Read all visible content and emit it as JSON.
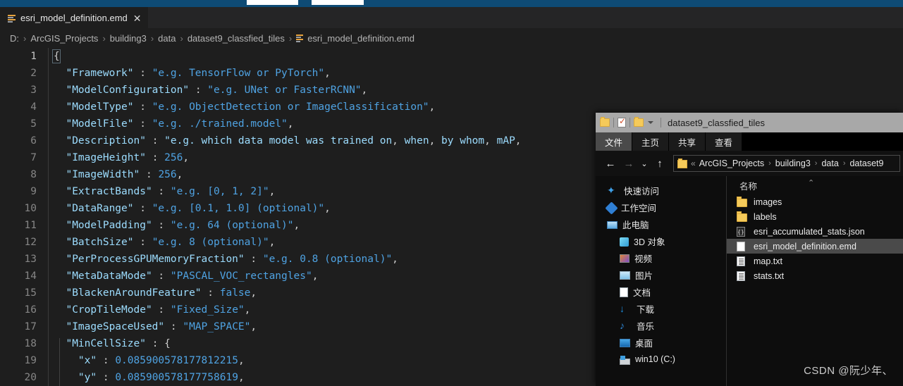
{
  "top_strip": {
    "color": "#0e4b75"
  },
  "editor": {
    "tab": {
      "label": "esri_model_definition.emd",
      "close_glyph": "✕",
      "icon": "json-lines-icon"
    },
    "breadcrumb": {
      "separator": "›",
      "parts": [
        "D:",
        "ArcGIS_Projects",
        "building3",
        "data",
        "dataset9_classfied_tiles"
      ],
      "file": "esri_model_definition.emd"
    },
    "lines": [
      {
        "n": "1",
        "text": "{"
      },
      {
        "n": "2",
        "text": "  \"Framework\" : \"e.g. TensorFlow or PyTorch\","
      },
      {
        "n": "3",
        "text": "  \"ModelConfiguration\" : \"e.g. UNet or FasterRCNN\","
      },
      {
        "n": "4",
        "text": "  \"ModelType\" : \"e.g. ObjectDetection or ImageClassification\","
      },
      {
        "n": "5",
        "text": "  \"ModelFile\" : \"e.g. ./trained.model\","
      },
      {
        "n": "6",
        "text": "  \"Description\" : \"e.g. which data model was trained on, when, by whom, mAP,"
      },
      {
        "n": "7",
        "text": "  \"ImageHeight\" : 256,"
      },
      {
        "n": "8",
        "text": "  \"ImageWidth\" : 256,"
      },
      {
        "n": "9",
        "text": "  \"ExtractBands\" : \"e.g. [0, 1, 2]\","
      },
      {
        "n": "10",
        "text": "  \"DataRange\" : \"e.g. [0.1, 1.0] (optional)\","
      },
      {
        "n": "11",
        "text": "  \"ModelPadding\" : \"e.g. 64 (optional)\","
      },
      {
        "n": "12",
        "text": "  \"BatchSize\" : \"e.g. 8 (optional)\","
      },
      {
        "n": "13",
        "text": "  \"PerProcessGPUMemoryFraction\" : \"e.g. 0.8 (optional)\","
      },
      {
        "n": "14",
        "text": "  \"MetaDataMode\" : \"PASCAL_VOC_rectangles\","
      },
      {
        "n": "15",
        "text": "  \"BlackenAroundFeature\" : false,"
      },
      {
        "n": "16",
        "text": "  \"CropTileMode\" : \"Fixed_Size\","
      },
      {
        "n": "17",
        "text": "  \"ImageSpaceUsed\" : \"MAP_SPACE\","
      },
      {
        "n": "18",
        "text": "  \"MinCellSize\" : {"
      },
      {
        "n": "19",
        "text": "    \"x\" : 0.085900578177812215,"
      },
      {
        "n": "20",
        "text": "    \"y\" : 0.085900578177758619,"
      }
    ]
  },
  "explorer": {
    "title": "dataset9_classfied_tiles",
    "quick_access": [
      "folder-icon",
      "properties-icon",
      "new-folder-icon",
      "customize-caret-icon"
    ],
    "ribbon_tabs": [
      {
        "label": "文件",
        "active": true
      },
      {
        "label": "主页",
        "active": false
      },
      {
        "label": "共享",
        "active": false
      },
      {
        "label": "查看",
        "active": false
      }
    ],
    "nav": {
      "back_glyph": "←",
      "forward_glyph": "→",
      "recent_glyph": "⌄",
      "up_glyph": "↑",
      "address_chevrons": "«",
      "address_parts": [
        "ArcGIS_Projects",
        "building3",
        "data",
        "dataset9"
      ],
      "address_separator": "›"
    },
    "sidebar": [
      {
        "label": "快速访问",
        "icon": "star-icon",
        "indent": false
      },
      {
        "label": "工作空间",
        "icon": "diamond-icon",
        "indent": false
      },
      {
        "label": "此电脑",
        "icon": "this-pc-icon",
        "indent": false
      },
      {
        "label": "3D 对象",
        "icon": "cube-icon",
        "indent": true
      },
      {
        "label": "视频",
        "icon": "video-icon",
        "indent": true
      },
      {
        "label": "图片",
        "icon": "pictures-icon",
        "indent": true
      },
      {
        "label": "文档",
        "icon": "documents-icon",
        "indent": true
      },
      {
        "label": "下载",
        "icon": "downloads-icon",
        "indent": true
      },
      {
        "label": "音乐",
        "icon": "music-icon",
        "indent": true
      },
      {
        "label": "桌面",
        "icon": "desktop-icon",
        "indent": true
      },
      {
        "label": "win10 (C:)",
        "icon": "drive-icon",
        "indent": true
      }
    ],
    "list": {
      "header": "名称",
      "sort_caret": "⌃",
      "rows": [
        {
          "name": "images",
          "icon": "folder-icon",
          "selected": false
        },
        {
          "name": "labels",
          "icon": "folder-icon",
          "selected": false
        },
        {
          "name": "esri_accumulated_stats.json",
          "icon": "json-file-icon",
          "selected": false
        },
        {
          "name": "esri_model_definition.emd",
          "icon": "generic-file-icon",
          "selected": true
        },
        {
          "name": "map.txt",
          "icon": "text-file-icon",
          "selected": false
        },
        {
          "name": "stats.txt",
          "icon": "text-file-icon",
          "selected": false
        }
      ]
    }
  },
  "watermark": {
    "text": "CSDN @阮少年、"
  }
}
